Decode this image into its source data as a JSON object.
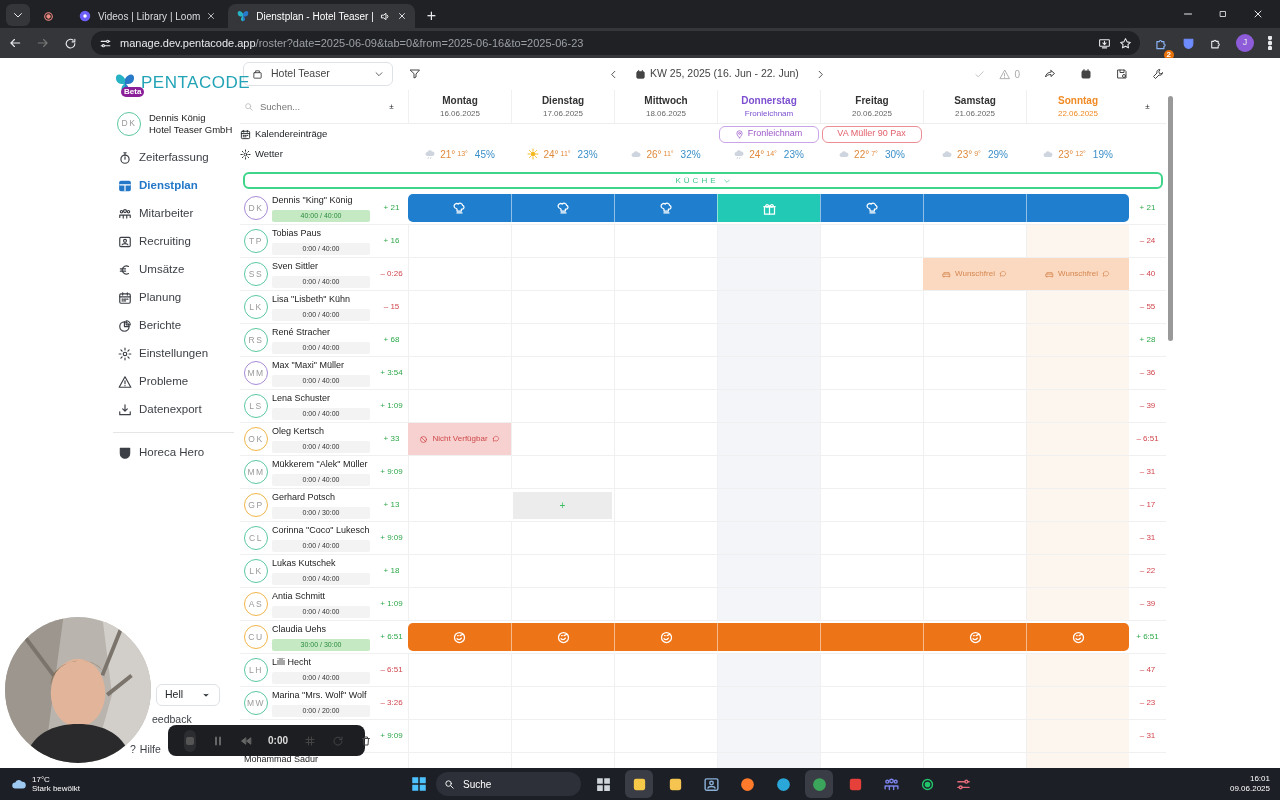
{
  "browser": {
    "tabs": [
      {
        "kind": "recording",
        "selected": false
      },
      {
        "kind": "page",
        "title": "Videos | Library | Loom",
        "selected": false,
        "audio": false
      },
      {
        "kind": "page",
        "title": "Dienstplan - Hotel Teaser |",
        "selected": true,
        "audio": true
      }
    ],
    "new_tab": "+",
    "url_host": "manage.dev.pentacode.app",
    "url_path": "/roster?date=2025-06-09&tab=0&from=2025-06-16&to=2025-06-23",
    "profile": "J",
    "extension_badge": "2"
  },
  "sidebar": {
    "logo": "PENTACODE",
    "badge": "Beta",
    "user": {
      "initials": "DK",
      "name": "Dennis König",
      "company": "Hotel Teaser GmbH"
    },
    "items": [
      {
        "label": "Zeiterfassung",
        "selected": false
      },
      {
        "label": "Dienstplan",
        "selected": true
      },
      {
        "label": "Mitarbeiter",
        "selected": false
      },
      {
        "label": "Recruiting",
        "selected": false
      },
      {
        "label": "Umsätze",
        "selected": false
      },
      {
        "label": "Planung",
        "selected": false
      },
      {
        "label": "Berichte",
        "selected": false
      },
      {
        "label": "Einstellungen",
        "selected": false
      },
      {
        "label": "Probleme",
        "selected": false
      },
      {
        "label": "Datenexport",
        "selected": false
      }
    ],
    "extra_items": [
      {
        "label": "Horeca Hero",
        "selected": false
      }
    ],
    "theme_select": "Hell",
    "links": [
      {
        "label": "eedback"
      },
      {
        "label": "Hilfe",
        "mark": "?"
      }
    ]
  },
  "toolbar": {
    "location": "Hotel Teaser",
    "week": "KW 25, 2025 (16. Jun - 22. Jun)",
    "warnings": "0"
  },
  "table": {
    "search_placeholder": "Suchen...",
    "balance_header": "±",
    "total_header": "±",
    "calendar_label": "Kalendereinträge",
    "weather_label": "Wetter",
    "section": "KÜCHE",
    "days": [
      {
        "name": "Montag",
        "sub": "16.06.2025",
        "kind": "weekday",
        "weather": {
          "kind": "rain",
          "high": "21°",
          "low": "13°",
          "rain": "45%"
        }
      },
      {
        "name": "Dienstag",
        "sub": "17.06.2025",
        "kind": "weekday",
        "weather": {
          "kind": "sun",
          "high": "24°",
          "low": "11°",
          "rain": "23%"
        }
      },
      {
        "name": "Mittwoch",
        "sub": "18.06.2025",
        "kind": "weekday",
        "weather": {
          "kind": "cloud",
          "high": "26°",
          "low": "11°",
          "rain": "32%"
        }
      },
      {
        "name": "Donnerstag",
        "sub": "Fronleichnam",
        "kind": "holiday",
        "weather": {
          "kind": "rain",
          "high": "24°",
          "low": "14°",
          "rain": "23%"
        },
        "event": {
          "label": "Fronleichnam",
          "kind": "holiday"
        }
      },
      {
        "name": "Freitag",
        "sub": "20.06.2025",
        "kind": "weekday",
        "weather": {
          "kind": "cloud",
          "high": "22°",
          "low": "7°",
          "rain": "30%"
        },
        "event": {
          "label": "VA Müller 90 Pax",
          "kind": "event"
        }
      },
      {
        "name": "Samstag",
        "sub": "21.06.2025",
        "kind": "weekday",
        "weather": {
          "kind": "cloud",
          "high": "23°",
          "low": "9°",
          "rain": "29%"
        }
      },
      {
        "name": "Sonntag",
        "sub": "22.06.2025",
        "kind": "sunday",
        "weather": {
          "kind": "cloud",
          "high": "23°",
          "low": "12°",
          "rain": "19%"
        }
      }
    ],
    "employees": [
      {
        "initials": "DK",
        "name": "Dennis \"King\" König",
        "color": "#a78bd6",
        "hours": "40:00 / 40:00",
        "full": true,
        "balance": "+ 21",
        "balance_positive": true,
        "total": "+ 21",
        "total_positive": true,
        "cells": [
          {
            "kind": "chef",
            "color": "#1f7fce"
          },
          {
            "kind": "chef",
            "color": "#1f7fce"
          },
          {
            "kind": "chef",
            "color": "#1f7fce"
          },
          {
            "kind": "gift",
            "color": "#22c9b4"
          },
          {
            "kind": "chef",
            "color": "#1f7fce"
          },
          {
            "kind": "bar",
            "color": "#1f7fce"
          },
          {
            "kind": "bar",
            "color": "#1f7fce"
          }
        ]
      },
      {
        "initials": "TP",
        "name": "Tobias Paus",
        "color": "#5cc8a0",
        "hours": "0:00 / 40:00",
        "full": false,
        "balance": "+ 16",
        "balance_positive": true,
        "total": "– 24",
        "total_positive": false
      },
      {
        "initials": "SS",
        "name": "Sven Sittler",
        "color": "#5cc8a0",
        "hours": "0:00 / 40:00",
        "full": false,
        "balance": "– 0:26",
        "balance_positive": false,
        "total": "– 40",
        "total_positive": false,
        "cells": [
          {
            "kind": "empty"
          },
          {
            "kind": "empty"
          },
          {
            "kind": "empty"
          },
          {
            "kind": "empty"
          },
          {
            "kind": "empty"
          },
          {
            "kind": "wish",
            "label": "Wunschfrei"
          },
          {
            "kind": "wish",
            "label": "Wunschfrei"
          }
        ]
      },
      {
        "initials": "LK",
        "name": "Lisa \"Lisbeth\" Kühn",
        "color": "#5cc8a0",
        "hours": "0:00 / 40:00",
        "full": false,
        "balance": "– 15",
        "balance_positive": false,
        "total": "– 55",
        "total_positive": false
      },
      {
        "initials": "RS",
        "name": "René Stracher",
        "color": "#5cc8a0",
        "hours": "0:00 / 40:00",
        "full": false,
        "balance": "+ 68",
        "balance_positive": true,
        "total": "+ 28",
        "total_positive": true
      },
      {
        "initials": "MM",
        "name": "Max \"Maxi\" Müller",
        "color": "#a78bd6",
        "hours": "0:00 / 40:00",
        "full": false,
        "balance": "+ 3:54",
        "balance_positive": true,
        "total": "– 36",
        "total_positive": false
      },
      {
        "initials": "LS",
        "name": "Lena Schuster",
        "color": "#5cc8a0",
        "hours": "0:00 / 40:00",
        "full": false,
        "balance": "+ 1:09",
        "balance_positive": true,
        "total": "– 39",
        "total_positive": false
      },
      {
        "initials": "OK",
        "name": "Oleg Kertsch",
        "color": "#f0b54a",
        "hours": "0:00 / 40:00",
        "full": false,
        "balance": "+ 33",
        "balance_positive": true,
        "total": "– 6:51",
        "total_positive": false,
        "cells": [
          {
            "kind": "unavailable",
            "label": "Nicht Verfügbar"
          }
        ]
      },
      {
        "initials": "MM",
        "name": "Mükkerem \"Alek\" Müller",
        "color": "#5cc8a0",
        "hours": "0:00 / 40:00",
        "full": false,
        "balance": "+ 9:09",
        "balance_positive": true,
        "total": "– 31",
        "total_positive": false
      },
      {
        "initials": "GP",
        "name": "Gerhard Potsch",
        "color": "#f0b54a",
        "hours": "0:00 / 30:00",
        "full": false,
        "balance": "+ 13",
        "balance_positive": true,
        "total": "– 17",
        "total_positive": false,
        "cells": [
          {
            "kind": "empty"
          },
          {
            "kind": "hover",
            "label": "+"
          }
        ]
      },
      {
        "initials": "CL",
        "name": "Corinna \"Coco\" Lukesch",
        "color": "#5cc8a0",
        "hours": "0:00 / 40:00",
        "full": false,
        "balance": "+ 9:09",
        "balance_positive": true,
        "total": "– 31",
        "total_positive": false
      },
      {
        "initials": "LK",
        "name": "Lukas Kutschek",
        "color": "#5cc8a0",
        "hours": "0:00 / 40:00",
        "full": false,
        "balance": "+ 18",
        "balance_positive": true,
        "total": "– 22",
        "total_positive": false
      },
      {
        "initials": "AS",
        "name": "Antia Schmitt",
        "color": "#f0b54a",
        "hours": "0:00 / 40:00",
        "full": false,
        "balance": "+ 1:09",
        "balance_positive": true,
        "total": "– 39",
        "total_positive": false
      },
      {
        "initials": "CU",
        "name": "Claudia Uehs",
        "color": "#f0b54a",
        "hours": "30:00 / 30:00",
        "full": true,
        "balance": "+ 6:51",
        "balance_positive": true,
        "total": "+ 6:51",
        "total_positive": true,
        "cells": [
          {
            "kind": "smile",
            "color": "#ee7418"
          },
          {
            "kind": "smile",
            "color": "#ee7418"
          },
          {
            "kind": "smile",
            "color": "#ee7418"
          },
          {
            "kind": "bar",
            "color": "#ee7418"
          },
          {
            "kind": "bar",
            "color": "#ee7418"
          },
          {
            "kind": "smile",
            "color": "#ee7418"
          },
          {
            "kind": "smile",
            "color": "#ee7418"
          }
        ]
      },
      {
        "initials": "LH",
        "name": "Lilli Hecht",
        "color": "#5cc8a0",
        "hours": "0:00 / 40:00",
        "full": false,
        "balance": "– 6:51",
        "balance_positive": false,
        "total": "– 47",
        "total_positive": false
      },
      {
        "initials": "MW",
        "name": "Marina \"Mrs. Wolf\" Wolf",
        "color": "#5cc8a0",
        "hours": "0:00 / 20:00",
        "full": false,
        "balance": "– 3:26",
        "balance_positive": false,
        "total": "– 23",
        "total_positive": false
      },
      {
        "balance": "+ 9:09",
        "balance_positive": true,
        "total": "– 31",
        "total_positive": false
      },
      {
        "name": "Mohammad Sadur"
      }
    ]
  },
  "recorder": {
    "time": "0:00"
  },
  "taskbar": {
    "temperature": "17°C",
    "weather": "Stark bewölkt",
    "search": "Suche",
    "time": "16:01",
    "date": "09.06.2025",
    "apps": [
      {
        "kind": "taskview",
        "selected": false
      },
      {
        "kind": "note",
        "selected": true
      },
      {
        "kind": "folder",
        "selected": false
      },
      {
        "kind": "calculator",
        "selected": false
      },
      {
        "kind": "browser",
        "color": "#ff7a2a",
        "selected": false
      },
      {
        "kind": "browser",
        "color": "#2aa7d8",
        "selected": false
      },
      {
        "kind": "browser",
        "color": "#3ba55c",
        "selected": true
      },
      {
        "kind": "remote",
        "selected": false
      },
      {
        "kind": "chat",
        "selected": false
      },
      {
        "kind": "app",
        "selected": false
      },
      {
        "kind": "snip",
        "selected": false
      }
    ]
  }
}
